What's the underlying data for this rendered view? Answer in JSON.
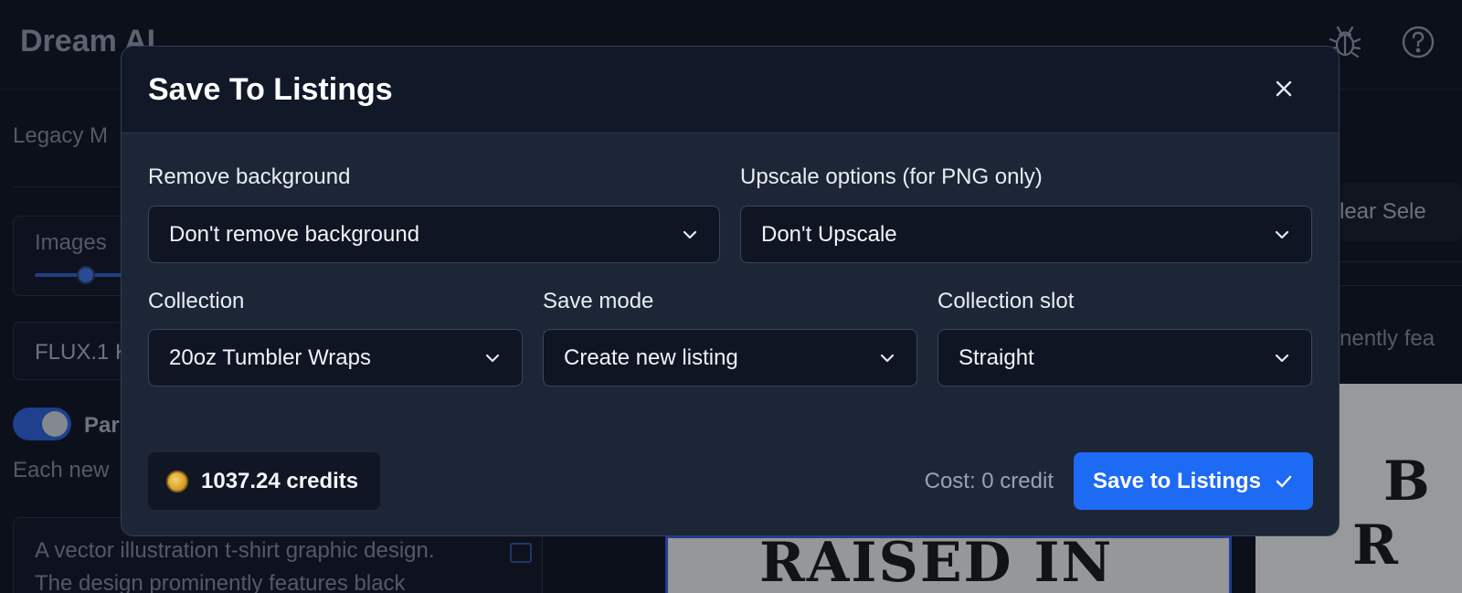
{
  "app": {
    "title": "Dream AI",
    "bug_icon": "bug-icon",
    "help_icon": "help-circle-icon"
  },
  "background": {
    "legacy_mode_label": "Legacy M",
    "images_label": "Images",
    "model_label": "FLUX.1 K",
    "toggle_label": "Par",
    "each_new_text": "Each new",
    "prompt_line1": "A vector illustration t-shirt graphic design.",
    "prompt_line2": "The design prominently features black",
    "clear_selection_label": "lear Sele",
    "right_text": "nently fea",
    "thumb1_text": "RAISED IN",
    "thumb2_text_top": "B",
    "thumb2_text_bottom": "R"
  },
  "modal": {
    "title": "Save To Listings",
    "close_icon": "close-icon",
    "remove_background": {
      "label": "Remove background",
      "value": "Don't remove background"
    },
    "upscale": {
      "label": "Upscale options (for PNG only)",
      "value": "Don't Upscale"
    },
    "collection": {
      "label": "Collection",
      "value": "20oz Tumbler Wraps"
    },
    "save_mode": {
      "label": "Save mode",
      "value": "Create new listing"
    },
    "collection_slot": {
      "label": "Collection slot",
      "value": "Straight"
    },
    "credits": "1037.24 credits",
    "cost": "Cost: 0 credit",
    "save_button": "Save to Listings"
  },
  "colors": {
    "accent": "#1d6af5",
    "modal_bg": "#1c2637",
    "header_bg": "#111827"
  }
}
